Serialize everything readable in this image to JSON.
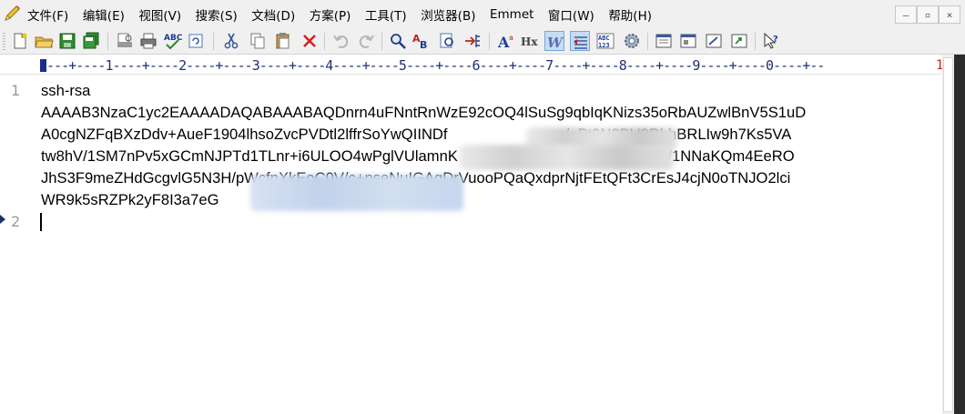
{
  "menubar": {
    "items": [
      "文件(F)",
      "编辑(E)",
      "视图(V)",
      "搜索(S)",
      "文档(D)",
      "方案(P)",
      "工具(T)",
      "浏览器(B)",
      "Emmet",
      "窗口(W)",
      "帮助(H)"
    ],
    "window_controls": [
      "–",
      "▫",
      "×"
    ]
  },
  "ruler": {
    "text": "---+----1----+----2----+----3----+----4----+----5----+----6----+----7----+----8----+----9----+----0----+--",
    "end_mark": "1"
  },
  "editor": {
    "line_numbers": [
      "1",
      "2"
    ],
    "lines": [
      "ssh-rsa",
      "AAAAB3NzaC1yc2EAAAADAQABAAABAQDnrn4uFNntRnWzE92cOQ4lSuSg9qbIqKNizs35oRbAUZwlBnV5S1uD",
      "A0cgNZFqBXzDdv+AueF1904lhsoZvcPVDtl2lffrSoYwQIINDf                            /oPt0N2BU9RbhBRLIw9h7Ks5VA",
      "tw8hV/1SM7nPv5xGCmNJPTd1TLnr+i6ULOO4wPglVUlamnK                               uSkjcMjEn4/1NNaKQm4EeRO",
      "JhS3F9meZHdGcgvlG5N3H/pWcfnXkEoC0V/c+nseNuIGAqDrVuooPQaQxdprNjtFEtQFt3CrEsJ4cjN0oTNJO2lci",
      "WR9k5sRZPk2yF8I3a7eG"
    ]
  },
  "colors": {
    "menubar_bg": "#f0f0f0",
    "ruler_text": "#1c3070",
    "line_number": "#9a9a9a"
  }
}
